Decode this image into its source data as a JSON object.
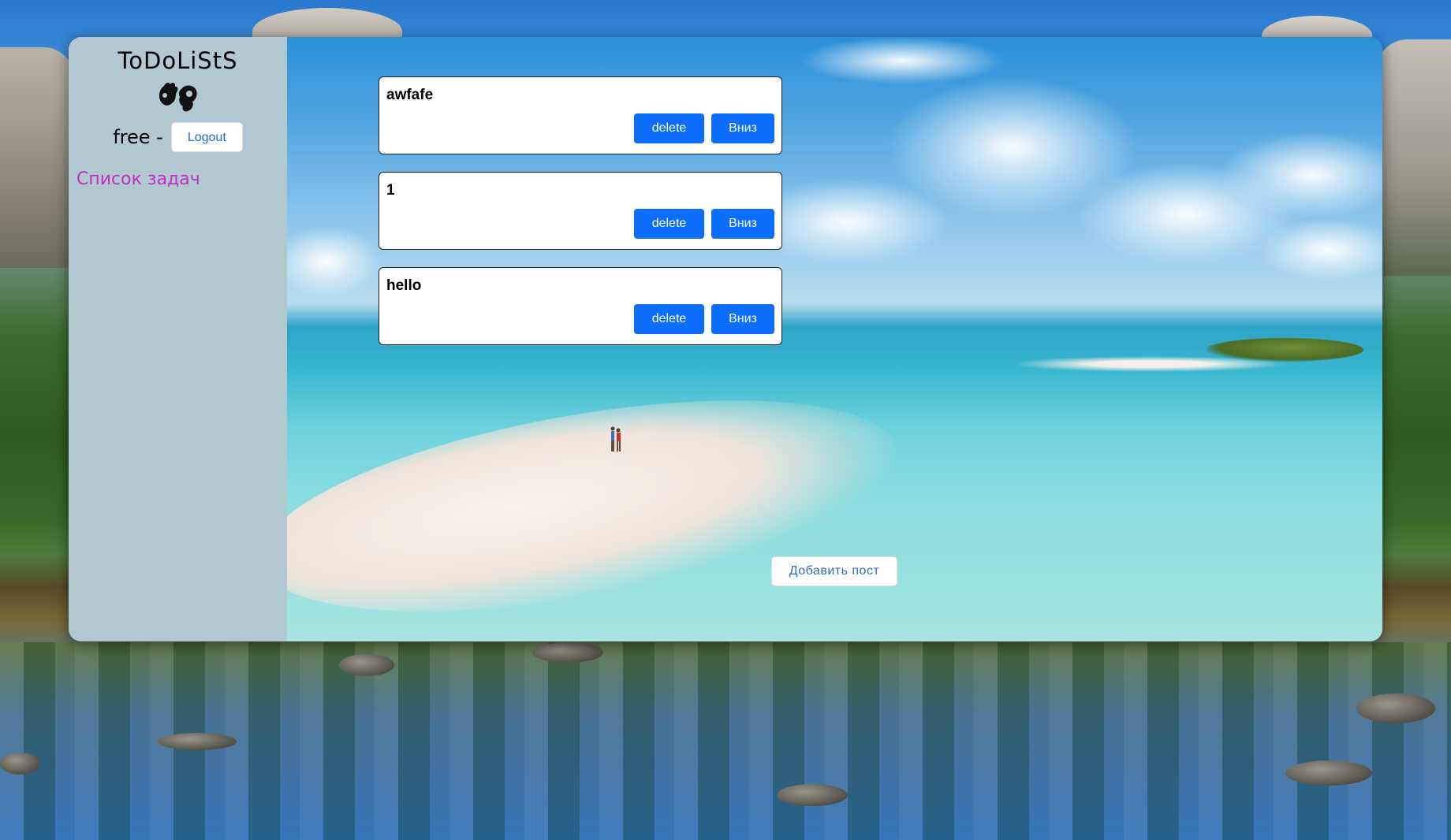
{
  "app": {
    "title": "ToDoLiStS"
  },
  "user": {
    "name": "free -",
    "logout_label": "Logout"
  },
  "nav": {
    "tasks_link": "Список задач",
    "link_color": "#c02fc0"
  },
  "tasks": [
    {
      "title": "awfafe",
      "delete_label": "delete",
      "down_label": "Вниз"
    },
    {
      "title": "1",
      "delete_label": "delete",
      "down_label": "Вниз"
    },
    {
      "title": "hello",
      "delete_label": "delete",
      "down_label": "Вниз"
    }
  ],
  "actions": {
    "add_post_label": "Добавить пост"
  },
  "colors": {
    "sidebar_bg": "#b2c8d1",
    "primary_button": "#0d6efd",
    "card_bg": "#ffffff"
  },
  "icons": {
    "logo": "hands-sign-language-icon"
  }
}
